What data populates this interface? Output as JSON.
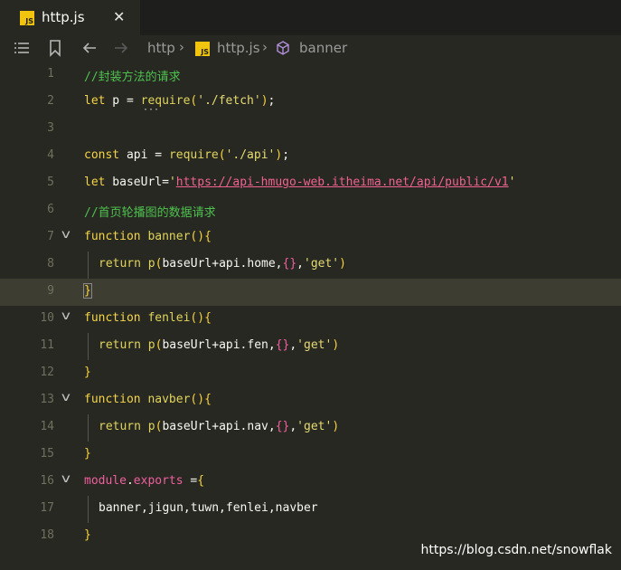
{
  "tab": {
    "title": "http.js",
    "badge": "JS",
    "close": "✕"
  },
  "breadcrumb": {
    "folder": "http",
    "file": "http.js",
    "symbol": "banner",
    "separator": "›"
  },
  "lines": [
    {
      "n": "1",
      "tokens": [
        [
          "cm",
          "//封装方法的请求"
        ]
      ]
    },
    {
      "n": "2",
      "tokens": [
        [
          "kw",
          "let"
        ],
        [
          "pl",
          " p = "
        ],
        [
          "fn",
          "require"
        ],
        [
          "br",
          "("
        ],
        [
          "str",
          "'./fetch'"
        ],
        [
          "br",
          ")"
        ],
        [
          "pl",
          ";"
        ]
      ],
      "dots": "···"
    },
    {
      "n": "3",
      "tokens": []
    },
    {
      "n": "4",
      "tokens": [
        [
          "kw",
          "const"
        ],
        [
          "pl",
          " api = "
        ],
        [
          "fn",
          "require"
        ],
        [
          "br",
          "("
        ],
        [
          "str",
          "'./api'"
        ],
        [
          "br",
          ")"
        ],
        [
          "pl",
          ";"
        ]
      ]
    },
    {
      "n": "5",
      "tokens": [
        [
          "kw",
          "let"
        ],
        [
          "pl",
          " baseUrl="
        ],
        [
          "str",
          "'"
        ],
        [
          "url",
          "https://api-hmugo-web.itheima.net/api/public/v1"
        ],
        [
          "str",
          "'"
        ]
      ]
    },
    {
      "n": "6",
      "tokens": [
        [
          "cm",
          "//首页轮播图的数据请求"
        ]
      ]
    },
    {
      "n": "7",
      "fold": true,
      "tokens": [
        [
          "kw",
          "function"
        ],
        [
          "pl",
          " "
        ],
        [
          "fn",
          "banner"
        ],
        [
          "br",
          "()"
        ],
        [
          "br",
          "{"
        ]
      ]
    },
    {
      "n": "8",
      "indent": true,
      "tokens": [
        [
          "ret",
          "return"
        ],
        [
          "pl",
          " "
        ],
        [
          "fn",
          "p"
        ],
        [
          "br",
          "("
        ],
        [
          "pl",
          "baseUrl+api.home,"
        ],
        [
          "pk",
          "{}"
        ],
        [
          "pl",
          ","
        ],
        [
          "str",
          "'get'"
        ],
        [
          "br",
          ")"
        ]
      ]
    },
    {
      "n": "9",
      "current": true,
      "tokens": [
        [
          "br",
          "}"
        ]
      ]
    },
    {
      "n": "10",
      "fold": true,
      "tokens": [
        [
          "kw",
          "function"
        ],
        [
          "pl",
          " "
        ],
        [
          "fn",
          "fenlei"
        ],
        [
          "br",
          "()"
        ],
        [
          "br",
          "{"
        ]
      ]
    },
    {
      "n": "11",
      "indent": true,
      "tokens": [
        [
          "ret",
          "return"
        ],
        [
          "pl",
          " "
        ],
        [
          "fn",
          "p"
        ],
        [
          "br",
          "("
        ],
        [
          "pl",
          "baseUrl+api.fen,"
        ],
        [
          "pk",
          "{}"
        ],
        [
          "pl",
          ","
        ],
        [
          "str",
          "'get'"
        ],
        [
          "br",
          ")"
        ]
      ]
    },
    {
      "n": "12",
      "tokens": [
        [
          "br",
          "}"
        ]
      ]
    },
    {
      "n": "13",
      "fold": true,
      "tokens": [
        [
          "kw",
          "function"
        ],
        [
          "pl",
          " "
        ],
        [
          "fn",
          "navber"
        ],
        [
          "br",
          "()"
        ],
        [
          "br",
          "{"
        ]
      ]
    },
    {
      "n": "14",
      "indent": true,
      "tokens": [
        [
          "ret",
          "return"
        ],
        [
          "pl",
          " "
        ],
        [
          "fn",
          "p"
        ],
        [
          "br",
          "("
        ],
        [
          "pl",
          "baseUrl+api.nav,"
        ],
        [
          "pk",
          "{}"
        ],
        [
          "pl",
          ","
        ],
        [
          "str",
          "'get'"
        ],
        [
          "br",
          ")"
        ]
      ]
    },
    {
      "n": "15",
      "tokens": [
        [
          "br",
          "}"
        ]
      ]
    },
    {
      "n": "16",
      "fold": true,
      "tokens": [
        [
          "pk",
          "module"
        ],
        [
          "pl",
          "."
        ],
        [
          "pk",
          "exports"
        ],
        [
          "pl",
          " ="
        ],
        [
          "br",
          "{"
        ]
      ]
    },
    {
      "n": "17",
      "indent": true,
      "tokens": [
        [
          "pl",
          "banner,jigun,tuwn,fenlei,navber"
        ]
      ]
    },
    {
      "n": "18",
      "tokens": [
        [
          "br",
          "}"
        ]
      ]
    }
  ],
  "watermark": "https://blog.csdn.net/snowflak",
  "colors": {
    "background": "#272822",
    "comment": "#4fc14f",
    "keyword": "#f5d547",
    "string": "#e6db74",
    "url": "#f06292"
  }
}
